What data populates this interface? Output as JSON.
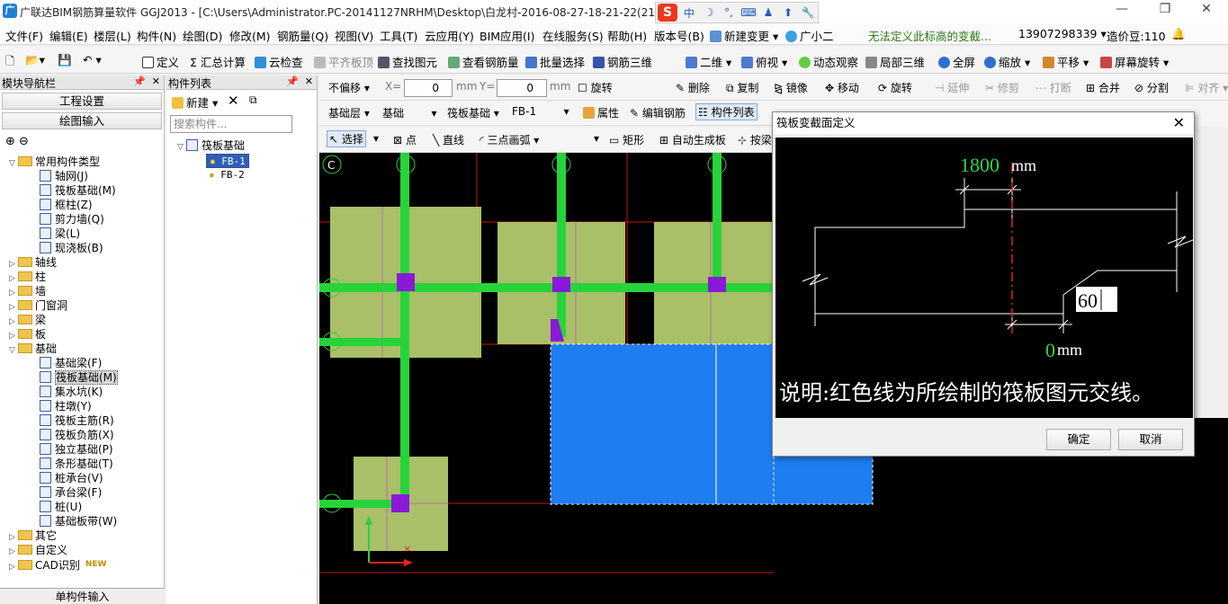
{
  "titlebar": {
    "title": "广联达BIM钢筋算量软件 GGJ2013 - [C:\\Users\\Administrator.PC-20141127NRHM\\Desktop\\白龙村-2016-08-27-18-21-22(216",
    "ime_items": [
      "中",
      "☽",
      "°,",
      "⌨",
      "♟",
      "⬆",
      "🔧"
    ]
  },
  "menubar": {
    "items": [
      "文件(F)",
      "编辑(E)",
      "楼层(L)",
      "构件(N)",
      "绘图(D)",
      "修改(M)",
      "钢筋量(Q)",
      "视图(V)",
      "工具(T)",
      "云应用(Y)",
      "BIM应用(I)",
      "在线服务(S)",
      "帮助(H)",
      "版本号(B)",
      "新建变更",
      "广小二"
    ],
    "notice": "无法定义此标高的变截...",
    "phone": "13907298339",
    "beans": "造价豆:110"
  },
  "toolbar1": {
    "items": [
      "定义",
      "Σ 汇总计算",
      "云检查",
      "平齐板顶",
      "查找图元",
      "查看钢筋量",
      "批量选择",
      "钢筋三维",
      "二维",
      "俯视",
      "动态观察",
      "局部三维",
      "全屏",
      "缩放",
      "平移",
      "屏幕旋转"
    ]
  },
  "left_panel": {
    "title": "模块导航栏",
    "btn_settings": "工程设置",
    "btn_draw": "绘图输入",
    "tree": [
      {
        "label": "常用构件类型",
        "level": 0,
        "folder": true,
        "open": true
      },
      {
        "label": "轴网(J)",
        "level": 1
      },
      {
        "label": "筏板基础(M)",
        "level": 1
      },
      {
        "label": "框柱(Z)",
        "level": 1
      },
      {
        "label": "剪力墙(Q)",
        "level": 1
      },
      {
        "label": "梁(L)",
        "level": 1
      },
      {
        "label": "现浇板(B)",
        "level": 1
      },
      {
        "label": "轴线",
        "level": 0,
        "folder": true
      },
      {
        "label": "柱",
        "level": 0,
        "folder": true
      },
      {
        "label": "墙",
        "level": 0,
        "folder": true
      },
      {
        "label": "门窗洞",
        "level": 0,
        "folder": true
      },
      {
        "label": "梁",
        "level": 0,
        "folder": true
      },
      {
        "label": "板",
        "level": 0,
        "folder": true
      },
      {
        "label": "基础",
        "level": 0,
        "folder": true,
        "open": true
      },
      {
        "label": "基础梁(F)",
        "level": 1
      },
      {
        "label": "筏板基础(M)",
        "level": 1,
        "selected": true
      },
      {
        "label": "集水坑(K)",
        "level": 1
      },
      {
        "label": "柱墩(Y)",
        "level": 1
      },
      {
        "label": "筏板主筋(R)",
        "level": 1
      },
      {
        "label": "筏板负筋(X)",
        "level": 1
      },
      {
        "label": "独立基础(P)",
        "level": 1
      },
      {
        "label": "条形基础(T)",
        "level": 1
      },
      {
        "label": "桩承台(V)",
        "level": 1
      },
      {
        "label": "承台梁(F)",
        "level": 1
      },
      {
        "label": "桩(U)",
        "level": 1
      },
      {
        "label": "基础板带(W)",
        "level": 1
      },
      {
        "label": "其它",
        "level": 0,
        "folder": true
      },
      {
        "label": "自定义",
        "level": 0,
        "folder": true
      },
      {
        "label": "CAD识别",
        "level": 0,
        "folder": true,
        "badge": "NEW"
      }
    ],
    "bottom": "单构件输入"
  },
  "component_list": {
    "title": "构件列表",
    "new_label": "新建",
    "search_placeholder": "搜索构件...",
    "root": "筏板基础",
    "items": [
      "FB-1",
      "FB-2"
    ]
  },
  "toolbar2": {
    "offset_mode": "不偏移",
    "x_label": "X=",
    "x_value": "0",
    "y_label": "Y=",
    "y_value": "0",
    "unit": "mm",
    "rotate": "旋转",
    "actions": [
      "删除",
      "复制",
      "镜像",
      "移动",
      "旋转",
      "延伸",
      "修剪",
      "打断",
      "合并",
      "分割",
      "对齐"
    ]
  },
  "toolbar3": {
    "floor": "基础层",
    "category": "基础",
    "type": "筏板基础",
    "component": "FB-1",
    "props": "属性",
    "edit_rebar": "编辑钢筋",
    "comp_list": "构件列表"
  },
  "toolbar4": {
    "select": "选择",
    "point": "点",
    "line": "直线",
    "arc": "三点画弧",
    "rect": "矩形",
    "auto": "自动生成板",
    "by": "按梁"
  },
  "canvas": {
    "axis_c": "C"
  },
  "dialog": {
    "title": "筏板变截面定义",
    "dim_top": "1800",
    "dim_top_unit": "mm",
    "angle_value": "60",
    "dim_bottom": "0",
    "dim_bottom_unit": "mm",
    "note": "说明:红色线为所绘制的筏板图元交线。",
    "ok": "确定",
    "cancel": "取消"
  },
  "colors": {
    "slab": "#a9bf68",
    "beam": "#27d33a",
    "column": "#8a19d6",
    "selected_slab": "#1e7df0",
    "grid": "#c81414"
  }
}
